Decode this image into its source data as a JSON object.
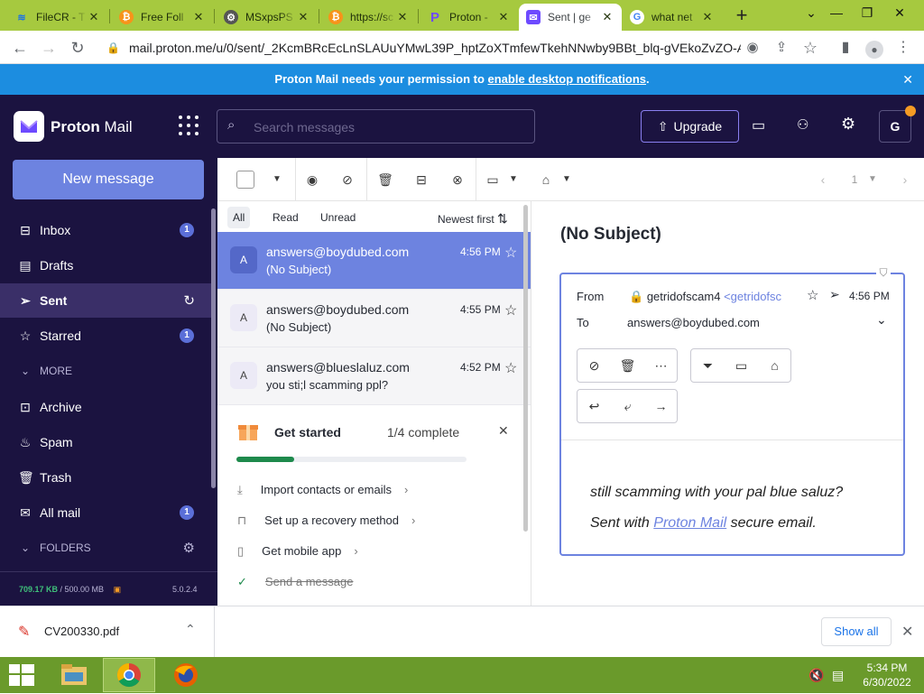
{
  "browser": {
    "tabs": [
      {
        "label": "FileCR - T",
        "icon": "filecr"
      },
      {
        "label": "Free Foll",
        "icon": "bitcoin"
      },
      {
        "label": "MSxpsPS",
        "icon": "gear"
      },
      {
        "label": "https://sc",
        "icon": "bitcoin"
      },
      {
        "label": "Proton -",
        "icon": "proton-p"
      },
      {
        "label": "Sent | ge",
        "icon": "protonmail"
      },
      {
        "label": "what net",
        "icon": "google"
      }
    ],
    "url": "mail.proton.me/u/0/sent/_2KcmBRcEcLnSLAUuYMwL39P_hptZoXTmfewTkehNNwby9BBt_blq-gVEkoZvZO-A..."
  },
  "notification": {
    "text": "Proton Mail needs your permission to ",
    "link": "enable desktop notifications",
    "end": "."
  },
  "header": {
    "logo_text": "Proton",
    "logo_text2": "Mail",
    "search_placeholder": "Search messages",
    "upgrade_label": "Upgrade",
    "avatar_initial": "G"
  },
  "sidebar": {
    "new_message": "New message",
    "items": [
      {
        "label": "Inbox",
        "badge": "1"
      },
      {
        "label": "Drafts",
        "badge": ""
      },
      {
        "label": "Sent",
        "badge": ""
      },
      {
        "label": "Starred",
        "badge": "1"
      },
      {
        "label": "MORE"
      },
      {
        "label": "Archive"
      },
      {
        "label": "Spam"
      },
      {
        "label": "Trash"
      },
      {
        "label": "All mail",
        "badge": "1"
      },
      {
        "label": "FOLDERS"
      }
    ],
    "storage_used": "709.17 KB",
    "storage_total": " / 500.00 MB",
    "version": "5.0.2.4"
  },
  "toolbar": {
    "page": "1"
  },
  "list": {
    "filters": [
      "All",
      "Read",
      "Unread"
    ],
    "sort": "Newest first",
    "rows": [
      {
        "avatar": "A",
        "from": "answers@boydubed.com",
        "subject": "(No Subject)",
        "time": "4:56 PM"
      },
      {
        "avatar": "A",
        "from": "answers@boydubed.com",
        "subject": "(No Subject)",
        "time": "4:55 PM"
      },
      {
        "avatar": "A",
        "from": "answers@blueslaluz.com",
        "subject": "you sti;l scamming ppl?",
        "time": "4:52 PM"
      }
    ],
    "get_started": {
      "title": "Get started",
      "progress_text": "1/4 complete",
      "progress": 0.25,
      "items": [
        {
          "label": "Import contacts or emails",
          "done": false
        },
        {
          "label": "Set up a recovery method",
          "done": false
        },
        {
          "label": "Get mobile app",
          "done": false
        },
        {
          "label": "Send a message",
          "done": true
        }
      ]
    }
  },
  "reader": {
    "subject": "(No Subject)",
    "from_label": "From",
    "from_name": "getridofscam4",
    "from_addr": "<getridofsc",
    "time": "4:56 PM",
    "to_label": "To",
    "to": "answers@boydubed.com",
    "body": "still scamming with your pal blue saluz?",
    "signature_pre": "Sent with ",
    "signature_link": "Proton Mail",
    "signature_post": " secure email."
  },
  "downloads": {
    "file": "CV200330.pdf",
    "show_all": "Show all"
  },
  "taskbar": {
    "time": "5:34 PM",
    "date": "6/30/2022"
  }
}
